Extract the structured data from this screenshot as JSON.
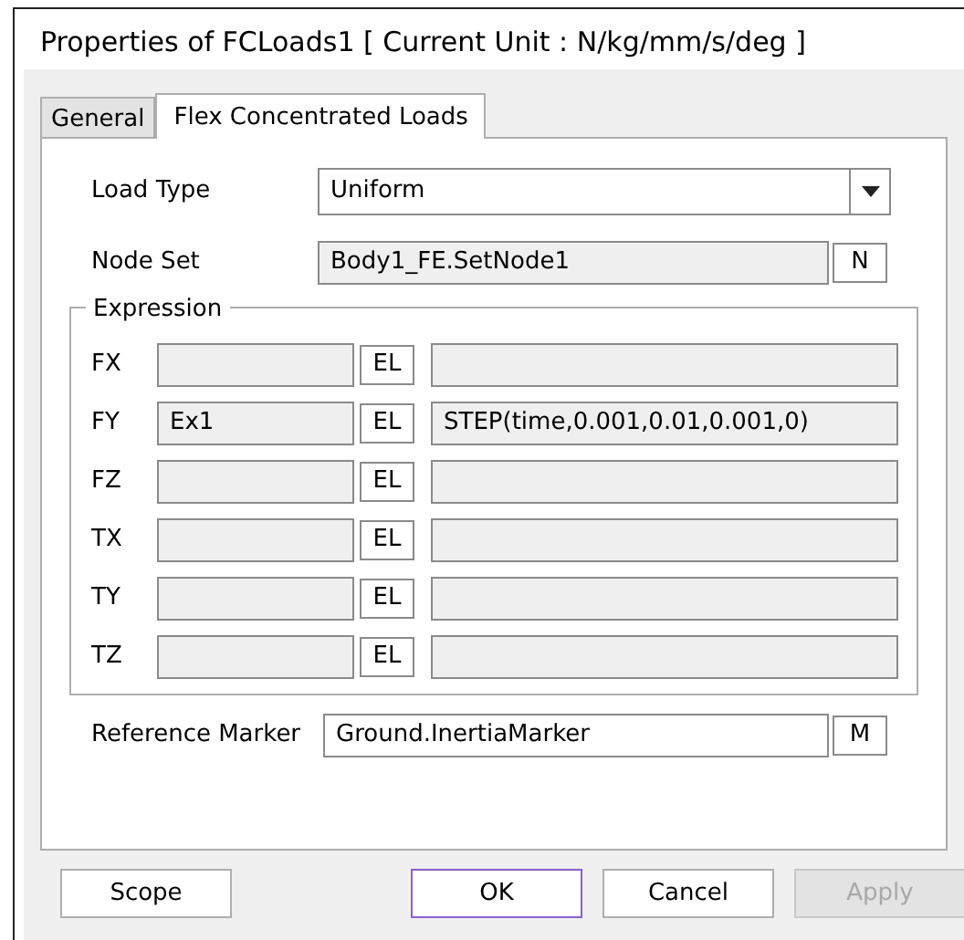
{
  "window": {
    "title": "Properties of FCLoads1 [ Current Unit : N/kg/mm/s/deg ]"
  },
  "tabs": [
    {
      "label": "General",
      "selected": false
    },
    {
      "label": "Flex Concentrated Loads",
      "selected": true
    }
  ],
  "load_type": {
    "label": "Load Type",
    "value": "Uniform"
  },
  "node_set": {
    "label": "Node Set",
    "value": "Body1_FE.SetNode1",
    "readonly": true,
    "button": "N"
  },
  "expression": {
    "title": "Expression",
    "rows": [
      {
        "label": "FX",
        "name": "",
        "button": "EL",
        "expression": ""
      },
      {
        "label": "FY",
        "name": "Ex1",
        "button": "EL",
        "expression": "STEP(time,0.001,0.01,0.001,0)"
      },
      {
        "label": "FZ",
        "name": "",
        "button": "EL",
        "expression": ""
      },
      {
        "label": "TX",
        "name": "",
        "button": "EL",
        "expression": ""
      },
      {
        "label": "TY",
        "name": "",
        "button": "EL",
        "expression": ""
      },
      {
        "label": "TZ",
        "name": "",
        "button": "EL",
        "expression": ""
      }
    ]
  },
  "reference_marker": {
    "label": "Reference Marker",
    "value": "Ground.InertiaMarker",
    "readonly": false,
    "button": "M"
  },
  "buttons": [
    {
      "label": "Scope",
      "disabled": false,
      "default": false
    },
    {
      "label": "OK",
      "disabled": false,
      "default": true
    },
    {
      "label": "Cancel",
      "disabled": false,
      "default": false
    },
    {
      "label": "Apply",
      "disabled": true,
      "default": false
    }
  ]
}
